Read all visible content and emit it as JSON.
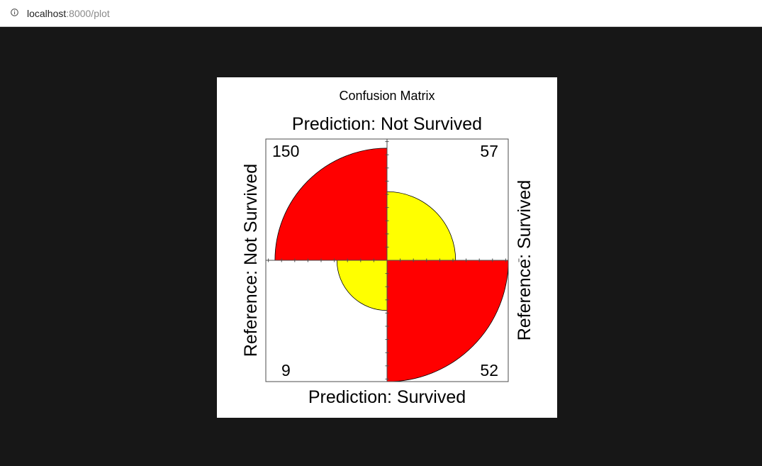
{
  "browser": {
    "url_host": "localhost",
    "url_rest": ":8000/plot"
  },
  "chart_data": {
    "type": "fourfold",
    "title": "Confusion Matrix",
    "top_label": "Prediction: Not Survived",
    "bottom_label": "Prediction: Survived",
    "left_label": "Reference: Not Survived",
    "right_label": "Reference: Survived",
    "cells": [
      {
        "quadrant": "top-left",
        "count": 150,
        "color": "#ff0000"
      },
      {
        "quadrant": "top-right",
        "count": 57,
        "color": "#ffff00"
      },
      {
        "quadrant": "bottom-left",
        "count": 9,
        "color": "#ffff00"
      },
      {
        "quadrant": "bottom-right",
        "count": 52,
        "color": "#ff0000"
      }
    ],
    "std_radii": [
      0.85,
      0.52,
      0.38,
      0.92
    ]
  }
}
